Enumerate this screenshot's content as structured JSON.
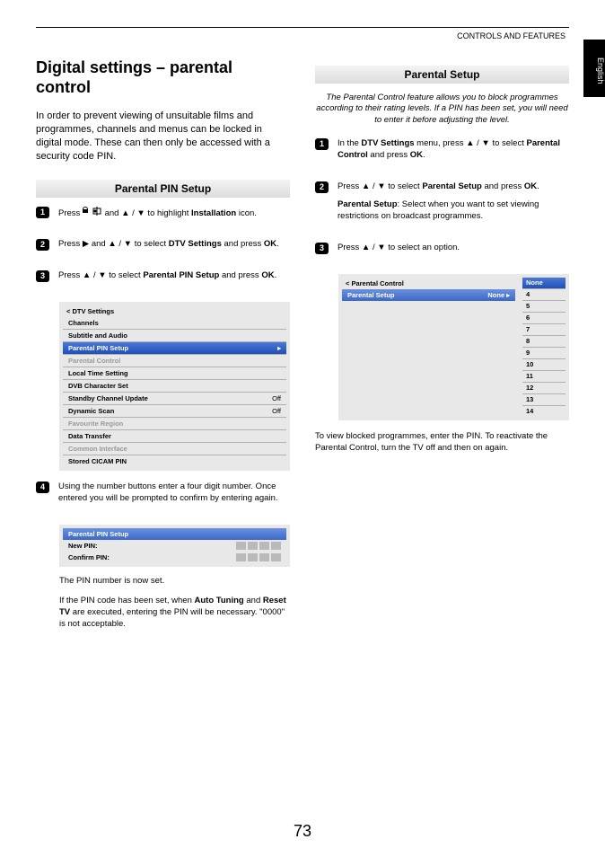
{
  "header": "CONTROLS AND FEATURES",
  "side_tab": "English",
  "page_number": "73",
  "left": {
    "title": "Digital settings – parental control",
    "intro": "In order to prevent viewing of unsuitable films and programmes, channels and menus can be locked in digital mode. These can then only be accessed with a security code PIN.",
    "section": "Parental PIN Setup",
    "step1_a": "Press ",
    "step1_b": " and ▲ / ▼ to highlight ",
    "step1_bold": "Installation",
    "step1_c": " icon.",
    "step2_a": "Press ▶ and ▲ / ▼ to select ",
    "step2_bold": "DTV Settings",
    "step2_b": " and press ",
    "step2_ok": "OK",
    "step2_c": ".",
    "step3_a": "Press ▲ / ▼ to select ",
    "step3_bold": "Parental PIN Setup",
    "step3_b": " and press ",
    "step3_ok": "OK",
    "step3_c": ".",
    "dtv_title": "< DTV Settings",
    "dtv_items": [
      {
        "label": "Channels",
        "val": "",
        "sel": false,
        "dis": false
      },
      {
        "label": "Subtitle and Audio",
        "val": "",
        "sel": false,
        "dis": false
      },
      {
        "label": "Parental PIN Setup",
        "val": "▸",
        "sel": true,
        "dis": false
      },
      {
        "label": "Parental Control",
        "val": "",
        "sel": false,
        "dis": true
      },
      {
        "label": "Local Time Setting",
        "val": "",
        "sel": false,
        "dis": false
      },
      {
        "label": "DVB Character Set",
        "val": "",
        "sel": false,
        "dis": false
      },
      {
        "label": "Standby Channel Update",
        "val": "Off",
        "sel": false,
        "dis": false
      },
      {
        "label": "Dynamic Scan",
        "val": "Off",
        "sel": false,
        "dis": false
      },
      {
        "label": "Favourite Region",
        "val": "",
        "sel": false,
        "dis": true
      },
      {
        "label": "Data Transfer",
        "val": "",
        "sel": false,
        "dis": false
      },
      {
        "label": "Common Interface",
        "val": "",
        "sel": false,
        "dis": true
      },
      {
        "label": "Stored CICAM PIN",
        "val": "",
        "sel": false,
        "dis": false
      }
    ],
    "step4": "Using the number buttons enter a four digit number. Once entered you will be prompted to confirm by entering again.",
    "pin_title": "Parental PIN Setup",
    "pin_new": "New PIN:",
    "pin_confirm": "Confirm PIN:",
    "note1": "The PIN number is now set.",
    "note2_a": "If the PIN code has been set, when ",
    "note2_b1": "Auto Tuning",
    "note2_c": " and ",
    "note2_b2": "Reset TV",
    "note2_d": " are executed, entering the PIN will be necessary. \"0000\" is not acceptable."
  },
  "right": {
    "section": "Parental Setup",
    "desc": "The Parental Control feature allows you to block programmes according to their rating levels. If a PIN has been set, you will need to enter it before adjusting the level.",
    "step1_a": "In the ",
    "step1_bold1": "DTV Settings",
    "step1_b": " menu, press ▲ / ▼ to select ",
    "step1_bold2": "Parental Control",
    "step1_c": " and press ",
    "step1_ok": "OK",
    "step1_d": ".",
    "step2_a": "Press ▲ / ▼ to select ",
    "step2_bold": "Parental Setup",
    "step2_b": " and press ",
    "step2_ok": "OK",
    "step2_c": ".",
    "step2_sub_bold": "Parental Setup",
    "step2_sub": ": Select when you want to set viewing restrictions on broadcast programmes.",
    "step3": "Press ▲ / ▼ to select an option.",
    "pc_title": "< Parental Control",
    "pc_row_label": "Parental Setup",
    "pc_row_val": "None   ▸",
    "options": [
      "None",
      "4",
      "5",
      "6",
      "7",
      "8",
      "9",
      "10",
      "11",
      "12",
      "13",
      "14"
    ],
    "footnote": "To view blocked programmes, enter the PIN. To reactivate the Parental Control, turn the TV off and then on again."
  }
}
